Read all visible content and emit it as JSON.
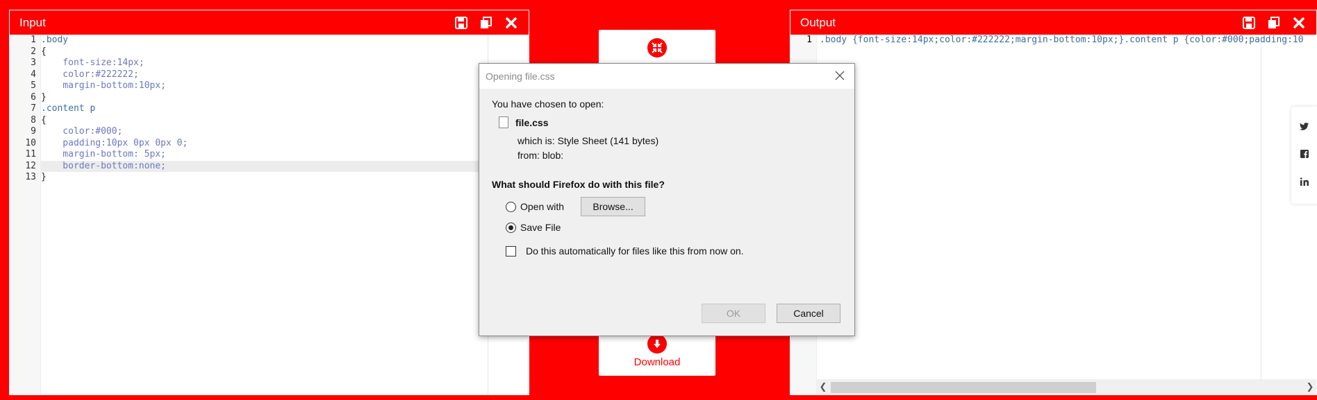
{
  "input_panel": {
    "title": "Input",
    "tools": [
      "save-icon",
      "copy-icon",
      "close-icon"
    ]
  },
  "output_panel": {
    "title": "Output",
    "tools": [
      "save-icon",
      "copy-icon",
      "close-icon"
    ],
    "line_number": "1",
    "output_code": ".body {font-size:14px;color:#222222;margin-bottom:10px;}.content p {color:#000;padding:10"
  },
  "editor": {
    "lines": [
      {
        "num": "1",
        "text": ".body"
      },
      {
        "num": "2",
        "text": "{"
      },
      {
        "num": "3",
        "text": "    font-size:14px;"
      },
      {
        "num": "4",
        "text": "    color:#222222;"
      },
      {
        "num": "5",
        "text": "    margin-bottom:10px;"
      },
      {
        "num": "6",
        "text": "}"
      },
      {
        "num": "7",
        "text": ".content p"
      },
      {
        "num": "8",
        "text": "{"
      },
      {
        "num": "9",
        "text": "    color:#000;"
      },
      {
        "num": "10",
        "text": "    padding:10px 0px 0px 0;"
      },
      {
        "num": "11",
        "text": "    margin-bottom: 5px;"
      },
      {
        "num": "12",
        "text": "    border-bottom:none;"
      },
      {
        "num": "13",
        "text": "}"
      }
    ],
    "active_line": 12
  },
  "download": {
    "label": "Download"
  },
  "social": [
    "twitter-icon",
    "facebook-icon",
    "linkedin-icon"
  ],
  "dialog": {
    "title": "Opening file.css",
    "intro": "You have chosen to open:",
    "file_name": "file.css",
    "which_is_label": "which is:",
    "which_is_value": "Style Sheet (141 bytes)",
    "from_label": "from:",
    "from_value": "blob:",
    "question": "What should Firefox do with this file?",
    "open_with_label": "Open with",
    "browse_label": "Browse...",
    "save_file_label": "Save File",
    "auto_label": "Do this automatically for files like this from now on.",
    "ok_label": "OK",
    "cancel_label": "Cancel",
    "selected_option": "save_file"
  },
  "colors": {
    "brand_red": "#ff0000"
  }
}
